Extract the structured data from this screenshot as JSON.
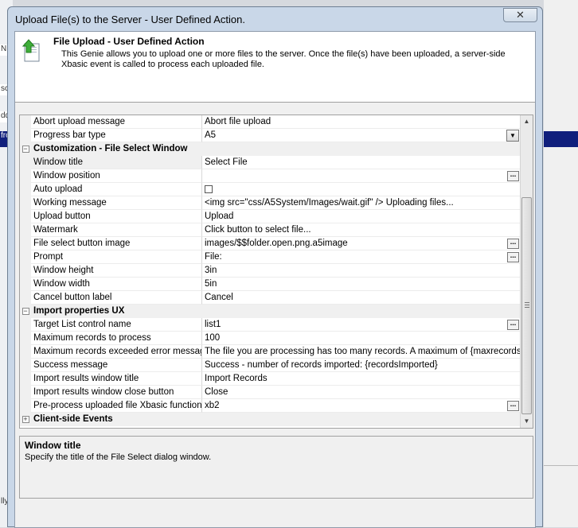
{
  "background": {
    "left_fragments": [
      "",
      "N",
      "",
      "o",
      "scr",
      "dd",
      "fro"
    ],
    "bottom_fragment": "lly"
  },
  "window": {
    "title": "Upload File(s) to the Server  - User Defined Action.",
    "close_glyph": "✕"
  },
  "header": {
    "icon": "upload-arrow-icon",
    "title": "File Upload - User Defined Action",
    "description": "This Genie allows you to upload one or more files to the server. Once the file(s) have been uploaded, a server-side Xbasic event is called to process each uploaded file."
  },
  "grid": {
    "rows": [
      {
        "type": "prop",
        "name": "Abort upload message",
        "value": "Abort file upload"
      },
      {
        "type": "prop",
        "name": "Progress bar type",
        "value": "A5",
        "editor": "dropdown"
      },
      {
        "type": "cat",
        "name": "Customization - File Select Window",
        "toggle": "−"
      },
      {
        "type": "prop",
        "name": "Window title",
        "value": "Select File",
        "selected": true
      },
      {
        "type": "prop",
        "name": "Window position",
        "value": "",
        "editor": "ellipsis"
      },
      {
        "type": "prop",
        "name": "Auto upload",
        "value": "",
        "editor": "checkbox"
      },
      {
        "type": "prop",
        "name": "Working message",
        "value": "<img src=\"css/A5System/Images/wait.gif\" /> Uploading files..."
      },
      {
        "type": "prop",
        "name": "Upload button",
        "value": "Upload"
      },
      {
        "type": "prop",
        "name": "Watermark",
        "value": "Click button to select file..."
      },
      {
        "type": "prop",
        "name": "File select button image",
        "value": "images/$$folder.open.png.a5image",
        "editor": "ellipsis"
      },
      {
        "type": "prop",
        "name": "Prompt",
        "value": "File:",
        "editor": "ellipsis"
      },
      {
        "type": "prop",
        "name": "Window height",
        "value": "3in"
      },
      {
        "type": "prop",
        "name": "Window width",
        "value": "5in"
      },
      {
        "type": "prop",
        "name": "Cancel button label",
        "value": "Cancel"
      },
      {
        "type": "cat",
        "name": "Import properties UX",
        "toggle": "−"
      },
      {
        "type": "prop",
        "name": "Target List control name",
        "value": "list1",
        "editor": "ellipsis"
      },
      {
        "type": "prop",
        "name": "Maximum records to process",
        "value": "100"
      },
      {
        "type": "prop",
        "name": "Maximum records exceeded error message",
        "value": "The file you are processing has too many records. A maximum of {maxrecords} records"
      },
      {
        "type": "prop",
        "name": "Success message",
        "value": "Success - number of records imported: {recordsImported}"
      },
      {
        "type": "prop",
        "name": "Import results window title",
        "value": "Import Records"
      },
      {
        "type": "prop",
        "name": "Import results window close button",
        "value": "Close"
      },
      {
        "type": "prop",
        "name": "Pre-process uploaded file Xbasic function",
        "value": "xb2",
        "editor": "ellipsis"
      },
      {
        "type": "cat",
        "name": "Client-side Events",
        "toggle": "+"
      }
    ],
    "ellipsis_label": "...",
    "dropdown_glyph": "▼",
    "scroll_up_glyph": "▲",
    "scroll_down_glyph": "▼"
  },
  "help": {
    "title": "Window title",
    "text": "Specify the title of the File Select dialog window."
  }
}
